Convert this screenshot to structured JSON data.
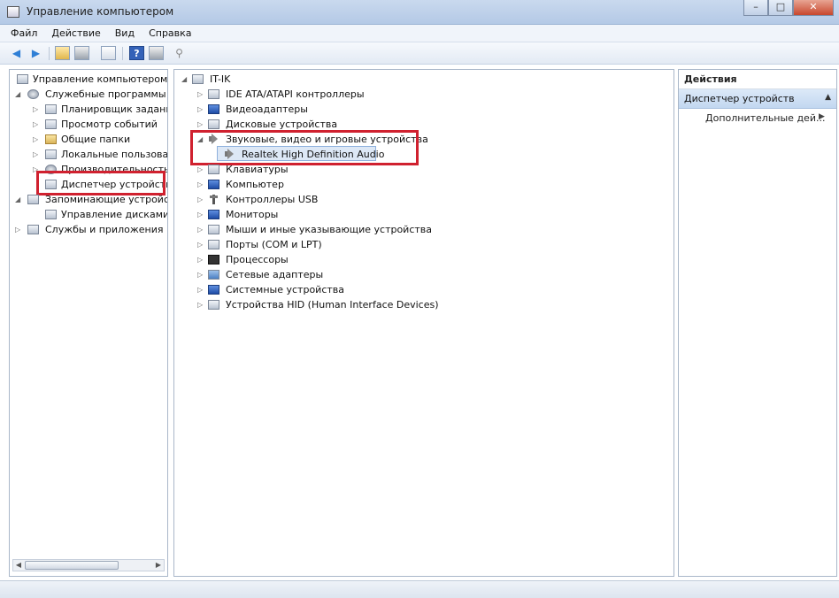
{
  "window": {
    "title": "Управление компьютером",
    "minimize": "–",
    "maximize": "□",
    "close": "✕"
  },
  "menu": [
    "Файл",
    "Действие",
    "Вид",
    "Справка"
  ],
  "toolbar": {
    "back_icon": "arrow-left-icon",
    "forward_icon": "arrow-right-icon",
    "help_label": "?"
  },
  "left_tree": {
    "root": "Управление компьютером (л",
    "system_tools": "Служебные программы",
    "task_scheduler": "Планировщик задани",
    "event_viewer": "Просмотр событий",
    "shared_folders": "Общие папки",
    "local_users": "Локальные пользовате",
    "performance": "Производительность",
    "device_manager": "Диспетчер устройств",
    "storage": "Запоминающие устройст",
    "disk_management": "Управление дисками",
    "services": "Службы и приложения"
  },
  "device_tree": {
    "computer": "IT-IK",
    "categories": [
      "IDE ATA/ATAPI контроллеры",
      "Видеоадаптеры",
      "Дисковые устройства",
      "Звуковые, видео и игровые устройства",
      "Клавиатуры",
      "Компьютер",
      "Контроллеры USB",
      "Мониторы",
      "Мыши и иные указывающие устройства",
      "Порты (COM и LPT)",
      "Процессоры",
      "Сетевые адаптеры",
      "Системные устройства",
      "Устройства HID (Human Interface Devices)"
    ],
    "sound_child": "Realtek High Definition Audio"
  },
  "actions": {
    "header": "Действия",
    "section": "Диспетчер устройств",
    "more_actions": "Дополнительные дей...",
    "more_arrow": "▶",
    "collapse_arrow": "▲"
  },
  "glyphs": {
    "expanded": "◢",
    "collapsed": "▷"
  },
  "colors": {
    "highlight_box": "#d0212f",
    "section_bg": "#c2d7f0"
  }
}
